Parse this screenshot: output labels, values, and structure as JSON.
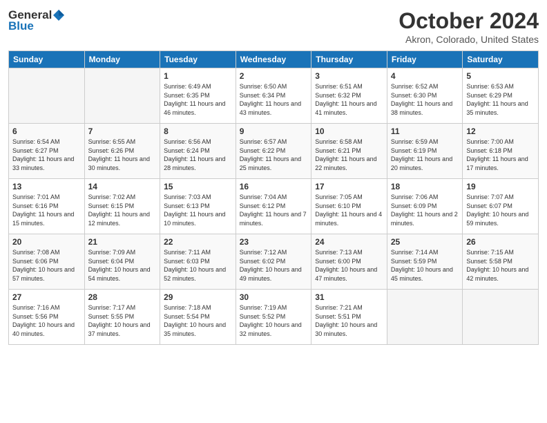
{
  "logo": {
    "general": "General",
    "blue": "Blue"
  },
  "title": "October 2024",
  "location": "Akron, Colorado, United States",
  "days_header": [
    "Sunday",
    "Monday",
    "Tuesday",
    "Wednesday",
    "Thursday",
    "Friday",
    "Saturday"
  ],
  "weeks": [
    [
      {
        "day": "",
        "sunrise": "",
        "sunset": "",
        "daylight": ""
      },
      {
        "day": "",
        "sunrise": "",
        "sunset": "",
        "daylight": ""
      },
      {
        "day": "1",
        "sunrise": "Sunrise: 6:49 AM",
        "sunset": "Sunset: 6:35 PM",
        "daylight": "Daylight: 11 hours and 46 minutes."
      },
      {
        "day": "2",
        "sunrise": "Sunrise: 6:50 AM",
        "sunset": "Sunset: 6:34 PM",
        "daylight": "Daylight: 11 hours and 43 minutes."
      },
      {
        "day": "3",
        "sunrise": "Sunrise: 6:51 AM",
        "sunset": "Sunset: 6:32 PM",
        "daylight": "Daylight: 11 hours and 41 minutes."
      },
      {
        "day": "4",
        "sunrise": "Sunrise: 6:52 AM",
        "sunset": "Sunset: 6:30 PM",
        "daylight": "Daylight: 11 hours and 38 minutes."
      },
      {
        "day": "5",
        "sunrise": "Sunrise: 6:53 AM",
        "sunset": "Sunset: 6:29 PM",
        "daylight": "Daylight: 11 hours and 35 minutes."
      }
    ],
    [
      {
        "day": "6",
        "sunrise": "Sunrise: 6:54 AM",
        "sunset": "Sunset: 6:27 PM",
        "daylight": "Daylight: 11 hours and 33 minutes."
      },
      {
        "day": "7",
        "sunrise": "Sunrise: 6:55 AM",
        "sunset": "Sunset: 6:26 PM",
        "daylight": "Daylight: 11 hours and 30 minutes."
      },
      {
        "day": "8",
        "sunrise": "Sunrise: 6:56 AM",
        "sunset": "Sunset: 6:24 PM",
        "daylight": "Daylight: 11 hours and 28 minutes."
      },
      {
        "day": "9",
        "sunrise": "Sunrise: 6:57 AM",
        "sunset": "Sunset: 6:22 PM",
        "daylight": "Daylight: 11 hours and 25 minutes."
      },
      {
        "day": "10",
        "sunrise": "Sunrise: 6:58 AM",
        "sunset": "Sunset: 6:21 PM",
        "daylight": "Daylight: 11 hours and 22 minutes."
      },
      {
        "day": "11",
        "sunrise": "Sunrise: 6:59 AM",
        "sunset": "Sunset: 6:19 PM",
        "daylight": "Daylight: 11 hours and 20 minutes."
      },
      {
        "day": "12",
        "sunrise": "Sunrise: 7:00 AM",
        "sunset": "Sunset: 6:18 PM",
        "daylight": "Daylight: 11 hours and 17 minutes."
      }
    ],
    [
      {
        "day": "13",
        "sunrise": "Sunrise: 7:01 AM",
        "sunset": "Sunset: 6:16 PM",
        "daylight": "Daylight: 11 hours and 15 minutes."
      },
      {
        "day": "14",
        "sunrise": "Sunrise: 7:02 AM",
        "sunset": "Sunset: 6:15 PM",
        "daylight": "Daylight: 11 hours and 12 minutes."
      },
      {
        "day": "15",
        "sunrise": "Sunrise: 7:03 AM",
        "sunset": "Sunset: 6:13 PM",
        "daylight": "Daylight: 11 hours and 10 minutes."
      },
      {
        "day": "16",
        "sunrise": "Sunrise: 7:04 AM",
        "sunset": "Sunset: 6:12 PM",
        "daylight": "Daylight: 11 hours and 7 minutes."
      },
      {
        "day": "17",
        "sunrise": "Sunrise: 7:05 AM",
        "sunset": "Sunset: 6:10 PM",
        "daylight": "Daylight: 11 hours and 4 minutes."
      },
      {
        "day": "18",
        "sunrise": "Sunrise: 7:06 AM",
        "sunset": "Sunset: 6:09 PM",
        "daylight": "Daylight: 11 hours and 2 minutes."
      },
      {
        "day": "19",
        "sunrise": "Sunrise: 7:07 AM",
        "sunset": "Sunset: 6:07 PM",
        "daylight": "Daylight: 10 hours and 59 minutes."
      }
    ],
    [
      {
        "day": "20",
        "sunrise": "Sunrise: 7:08 AM",
        "sunset": "Sunset: 6:06 PM",
        "daylight": "Daylight: 10 hours and 57 minutes."
      },
      {
        "day": "21",
        "sunrise": "Sunrise: 7:09 AM",
        "sunset": "Sunset: 6:04 PM",
        "daylight": "Daylight: 10 hours and 54 minutes."
      },
      {
        "day": "22",
        "sunrise": "Sunrise: 7:11 AM",
        "sunset": "Sunset: 6:03 PM",
        "daylight": "Daylight: 10 hours and 52 minutes."
      },
      {
        "day": "23",
        "sunrise": "Sunrise: 7:12 AM",
        "sunset": "Sunset: 6:02 PM",
        "daylight": "Daylight: 10 hours and 49 minutes."
      },
      {
        "day": "24",
        "sunrise": "Sunrise: 7:13 AM",
        "sunset": "Sunset: 6:00 PM",
        "daylight": "Daylight: 10 hours and 47 minutes."
      },
      {
        "day": "25",
        "sunrise": "Sunrise: 7:14 AM",
        "sunset": "Sunset: 5:59 PM",
        "daylight": "Daylight: 10 hours and 45 minutes."
      },
      {
        "day": "26",
        "sunrise": "Sunrise: 7:15 AM",
        "sunset": "Sunset: 5:58 PM",
        "daylight": "Daylight: 10 hours and 42 minutes."
      }
    ],
    [
      {
        "day": "27",
        "sunrise": "Sunrise: 7:16 AM",
        "sunset": "Sunset: 5:56 PM",
        "daylight": "Daylight: 10 hours and 40 minutes."
      },
      {
        "day": "28",
        "sunrise": "Sunrise: 7:17 AM",
        "sunset": "Sunset: 5:55 PM",
        "daylight": "Daylight: 10 hours and 37 minutes."
      },
      {
        "day": "29",
        "sunrise": "Sunrise: 7:18 AM",
        "sunset": "Sunset: 5:54 PM",
        "daylight": "Daylight: 10 hours and 35 minutes."
      },
      {
        "day": "30",
        "sunrise": "Sunrise: 7:19 AM",
        "sunset": "Sunset: 5:52 PM",
        "daylight": "Daylight: 10 hours and 32 minutes."
      },
      {
        "day": "31",
        "sunrise": "Sunrise: 7:21 AM",
        "sunset": "Sunset: 5:51 PM",
        "daylight": "Daylight: 10 hours and 30 minutes."
      },
      {
        "day": "",
        "sunrise": "",
        "sunset": "",
        "daylight": ""
      },
      {
        "day": "",
        "sunrise": "",
        "sunset": "",
        "daylight": ""
      }
    ]
  ]
}
